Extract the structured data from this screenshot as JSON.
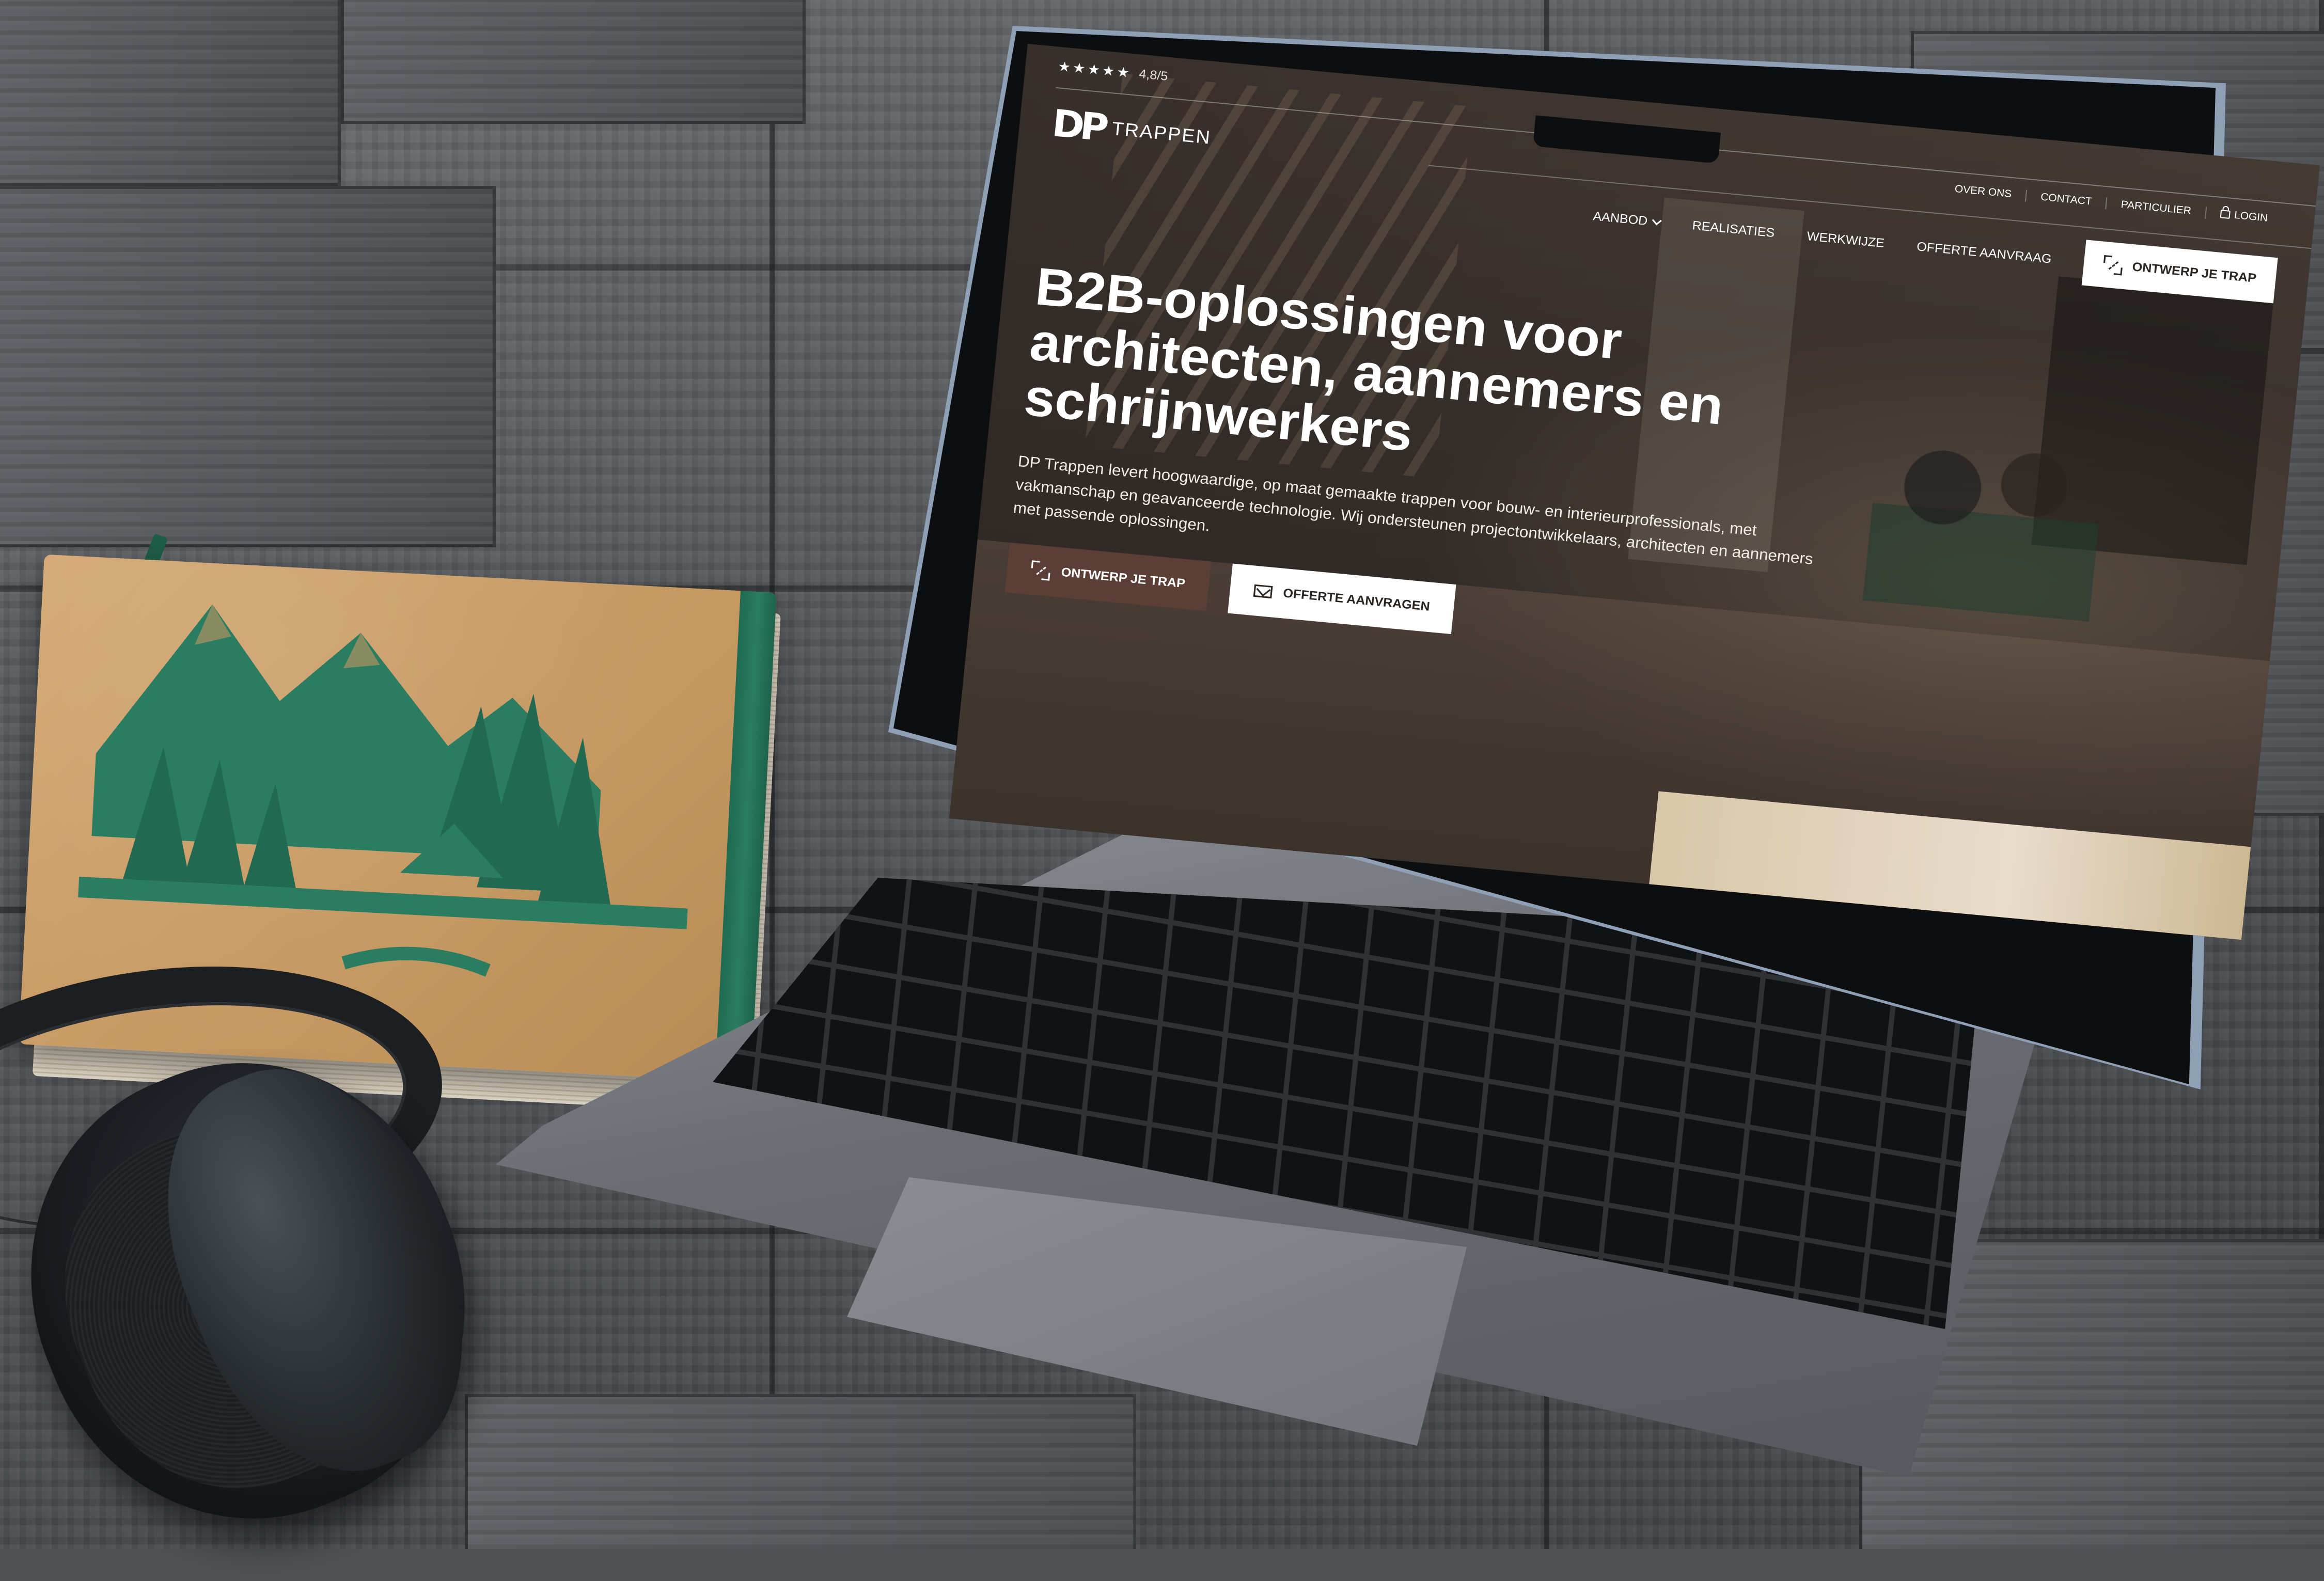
{
  "site": {
    "rating": {
      "stars": "★★★★★",
      "score": "4,8/5"
    },
    "logo": {
      "mark": "DP",
      "text": "TRAPPEN"
    },
    "utility_nav": {
      "over_ons": "OVER ONS",
      "contact": "CONTACT",
      "particulier": "PARTICULIER",
      "login": "LOGIN"
    },
    "main_nav": {
      "aanbod": "AANBOD",
      "realisaties": "REALISATIES",
      "werkwijze": "WERKWIJZE",
      "offerte_aanvraag": "OFFERTE AANVRAAG",
      "ontwerp_button": "ONTWERP JE TRAP"
    },
    "hero": {
      "title": "B2B-oplossingen voor architecten, aannemers en schrijnwerkers",
      "text": "DP Trappen levert hoogwaardige, op maat gemaakte trappen voor bouw- en interieurprofessionals, met vakmanschap en geavanceerde technologie. Wij ondersteunen projectontwikkelaars, architecten en aannemers met passende oplossingen.",
      "cta_primary": "ONTWERP JE TRAP",
      "cta_secondary": "OFFERTE AANVRAGEN"
    }
  },
  "colors": {
    "brown_button": "#5b3f36",
    "notebook_spine": "#2b7d61",
    "notebook_cover": "#c59761",
    "lid_edge": "#8da0b6"
  },
  "icons": [
    "star-icon",
    "chevron-down-icon",
    "lock-icon",
    "design-icon",
    "envelope-icon"
  ]
}
